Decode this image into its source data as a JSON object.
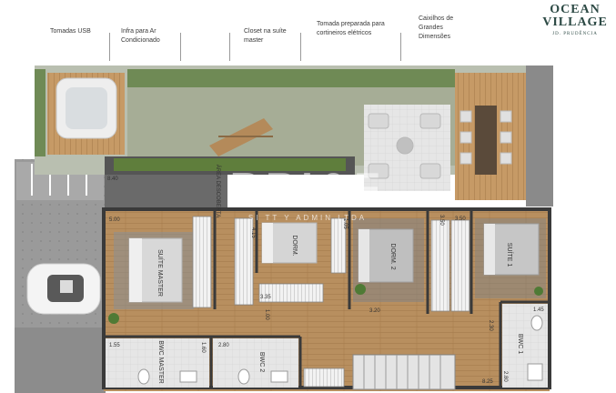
{
  "callouts": [
    {
      "text": "Tomadas USB"
    },
    {
      "text": "Infra para Ar Condicionado"
    },
    {
      "text": "Closet na suíte master"
    },
    {
      "text": "Tomada preparada para cortineiros elétricos"
    },
    {
      "text": "Caixilhos de Grandes Dimensões"
    }
  ],
  "logo": {
    "line1": "OCEAN",
    "line2": "VILLAGE",
    "line3": "JD. PRUDÊNCIA"
  },
  "watermark": {
    "main": "BRI&F",
    "sub": "SI  TT  Y  ADMIN  LTDA"
  },
  "rooms": {
    "suite_master": "SUÍTE MASTER",
    "dorm": "DORM.",
    "dorm2": "DORM. 2",
    "suite1": "SUÍTE 1",
    "bwc_master": "BWC MASTER",
    "bwc2": "BWC 2",
    "bwc1": "BWC 1",
    "area_descoberta": "ÁREA DESCOBERTA"
  },
  "dimensions": {
    "d_840": "8.40",
    "d_500": "5.00",
    "d_415": "4.15",
    "d_335": "3.35",
    "d_105": "1.05",
    "d_100": "1.00",
    "d_350a": "3.50",
    "d_350b": "3.50",
    "d_320": "3.20",
    "d_330": "3.30",
    "d_155": "1.55",
    "d_160": "1.60",
    "d_280a": "2.80",
    "d_145": "1.45",
    "d_230": "2.30",
    "d_280b": "2.80",
    "d_825": "8.25"
  },
  "colors": {
    "floor_wood": "#b58c5c",
    "wall": "#3d3d3d",
    "terrace": "#c9a06a",
    "lawn": "#8fa07a"
  }
}
